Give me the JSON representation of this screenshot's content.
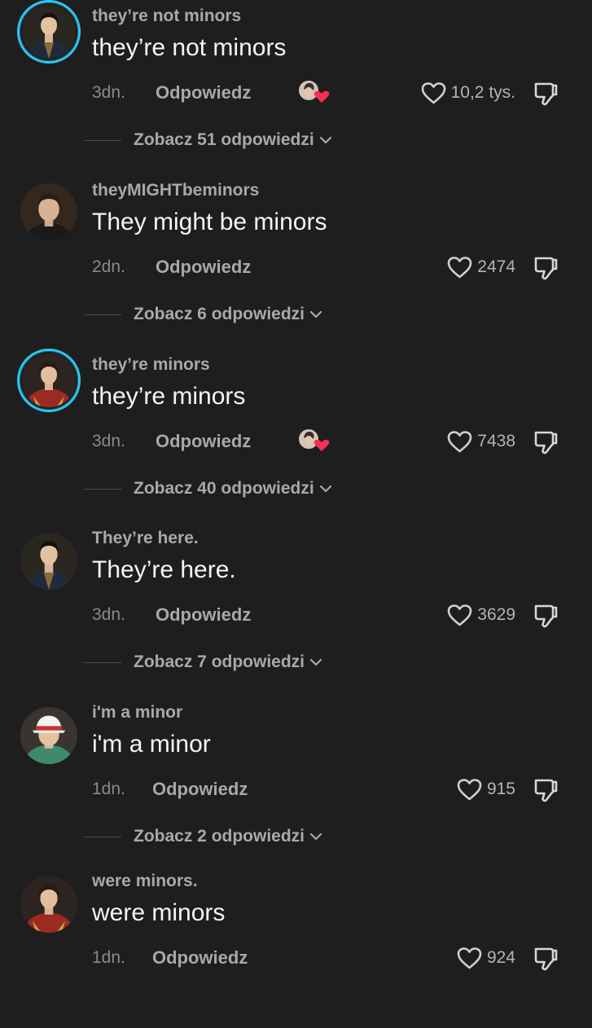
{
  "comments": [
    {
      "username": "they’re not minors",
      "text": "they’re not minors",
      "time": "3dn.",
      "reply_label": "Odpowiedz",
      "liked_by_creator": true,
      "likes": "10,2 tys.",
      "view_replies": "Zobacz 51 odpowiedzi",
      "has_story_ring": true,
      "avatar_icon": "avatar-dark-jacket"
    },
    {
      "username": "theyMIGHTbeminors",
      "text": "They might be minors",
      "time": "2dn.",
      "reply_label": "Odpowiedz",
      "liked_by_creator": false,
      "likes": "2474",
      "view_replies": "Zobacz 6 odpowiedzi",
      "has_story_ring": false,
      "avatar_icon": "avatar-short-hair"
    },
    {
      "username": "they’re minors",
      "text": "they’re minors",
      "time": "3dn.",
      "reply_label": "Odpowiedz",
      "liked_by_creator": true,
      "likes": "7438",
      "view_replies": "Zobacz 40 odpowiedzi",
      "has_story_ring": true,
      "avatar_icon": "avatar-red-jacket"
    },
    {
      "username": "They’re here.",
      "text": "They’re here.",
      "time": "3dn.",
      "reply_label": "Odpowiedz",
      "liked_by_creator": false,
      "likes": "3629",
      "view_replies": "Zobacz 7 odpowiedzi",
      "has_story_ring": false,
      "avatar_icon": "avatar-dark-jacket"
    },
    {
      "username": "i'm a minor",
      "text": "i'm a minor",
      "time": "1dn.",
      "reply_label": "Odpowiedz",
      "liked_by_creator": false,
      "likes": "915",
      "view_replies": "Zobacz 2 odpowiedzi",
      "has_story_ring": false,
      "avatar_icon": "avatar-cap"
    },
    {
      "username": "were minors.",
      "text": "were minors",
      "time": "1dn.",
      "reply_label": "Odpowiedz",
      "liked_by_creator": false,
      "likes": "924",
      "view_replies": null,
      "has_story_ring": false,
      "avatar_icon": "avatar-red-jacket"
    }
  ],
  "colors": {
    "background": "#1e1e1e",
    "story_ring": "#2cc7f0",
    "creator_heart": "#fe2c55"
  }
}
